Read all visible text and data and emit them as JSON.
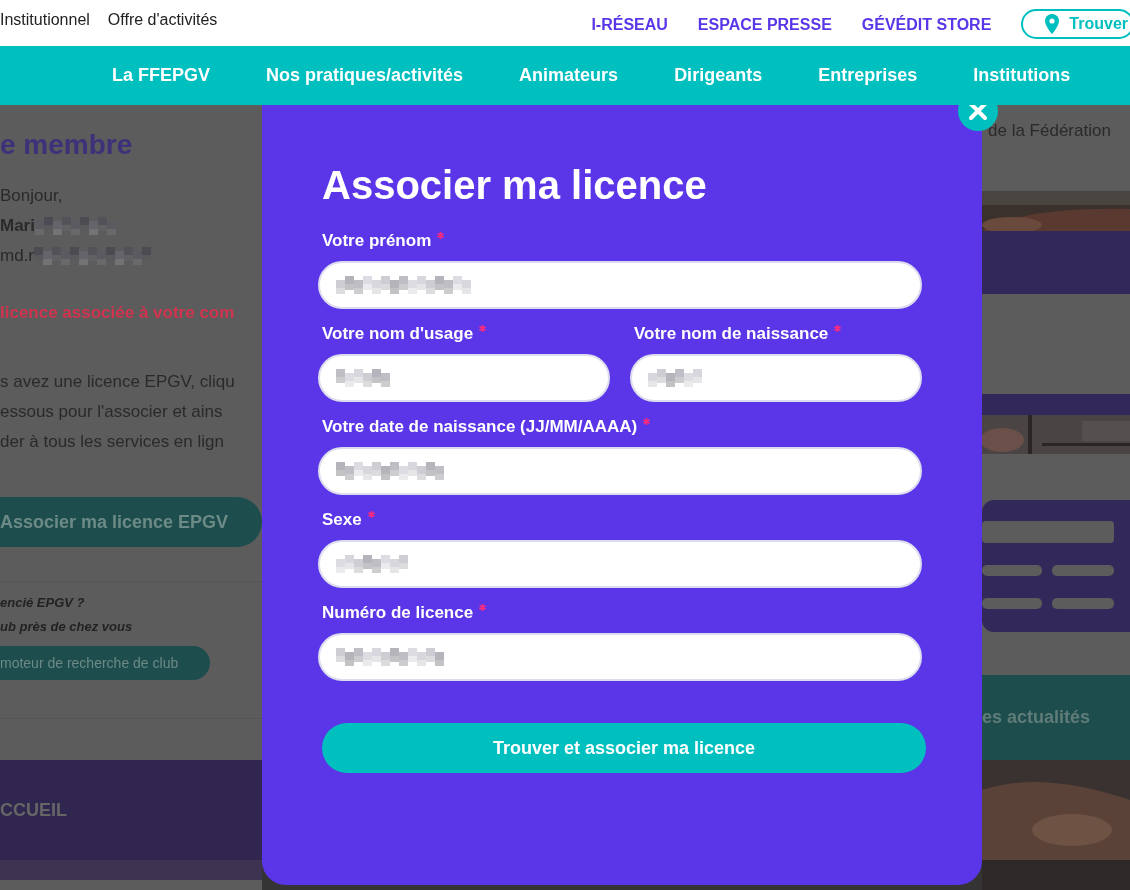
{
  "top_links": [
    "Institutionnel",
    "Offre d'activités"
  ],
  "utility_links": [
    "I-RÉSEAU",
    "ESPACE PRESSE",
    "GÉVÉDIT STORE"
  ],
  "find_button": "Trouver",
  "nav": [
    "La FFEPGV",
    "Nos pratiques/activités",
    "Animateurs",
    "Dirigeants",
    "Entreprises",
    "Institutions"
  ],
  "background_left": {
    "heading": "e membre",
    "greeting": "Bonjour,",
    "name": {
      "text": "Mari",
      "blurred": true
    },
    "email": {
      "text": "md.r",
      "blurred": true
    },
    "notice": "licence associée à votre com",
    "paragraph_lines": [
      "s avez une licence EPGV, cliqu",
      "essous pour l'associer et ains",
      "der à tous les services en lign"
    ],
    "associate_button": "Associer ma licence EPGV",
    "club_prompt": [
      "encié EPGV ?",
      "ub près de chez vous"
    ],
    "club_button": "moteur de recherche de club",
    "footer_label": "CCUEIL"
  },
  "background_right": {
    "text": "de la Fédération",
    "news_button": "es actualités"
  },
  "modal": {
    "title": "Associer ma licence",
    "rows": [
      [
        {
          "label": "Votre prénom",
          "required": true,
          "redacted": true
        }
      ],
      [
        {
          "label": "Votre nom d'usage",
          "required": true,
          "redacted": true
        },
        {
          "label": "Votre nom de naissance",
          "required": true,
          "redacted": true
        }
      ],
      [
        {
          "label": "Votre date de naissance (JJ/MM/AAAA)",
          "required": true,
          "redacted": true
        }
      ],
      [
        {
          "label": "Sexe",
          "required": true,
          "redacted": true
        }
      ],
      [
        {
          "label": "Numéro de licence",
          "required": true,
          "redacted": true
        }
      ]
    ],
    "submit": "Trouver et associer ma licence"
  }
}
